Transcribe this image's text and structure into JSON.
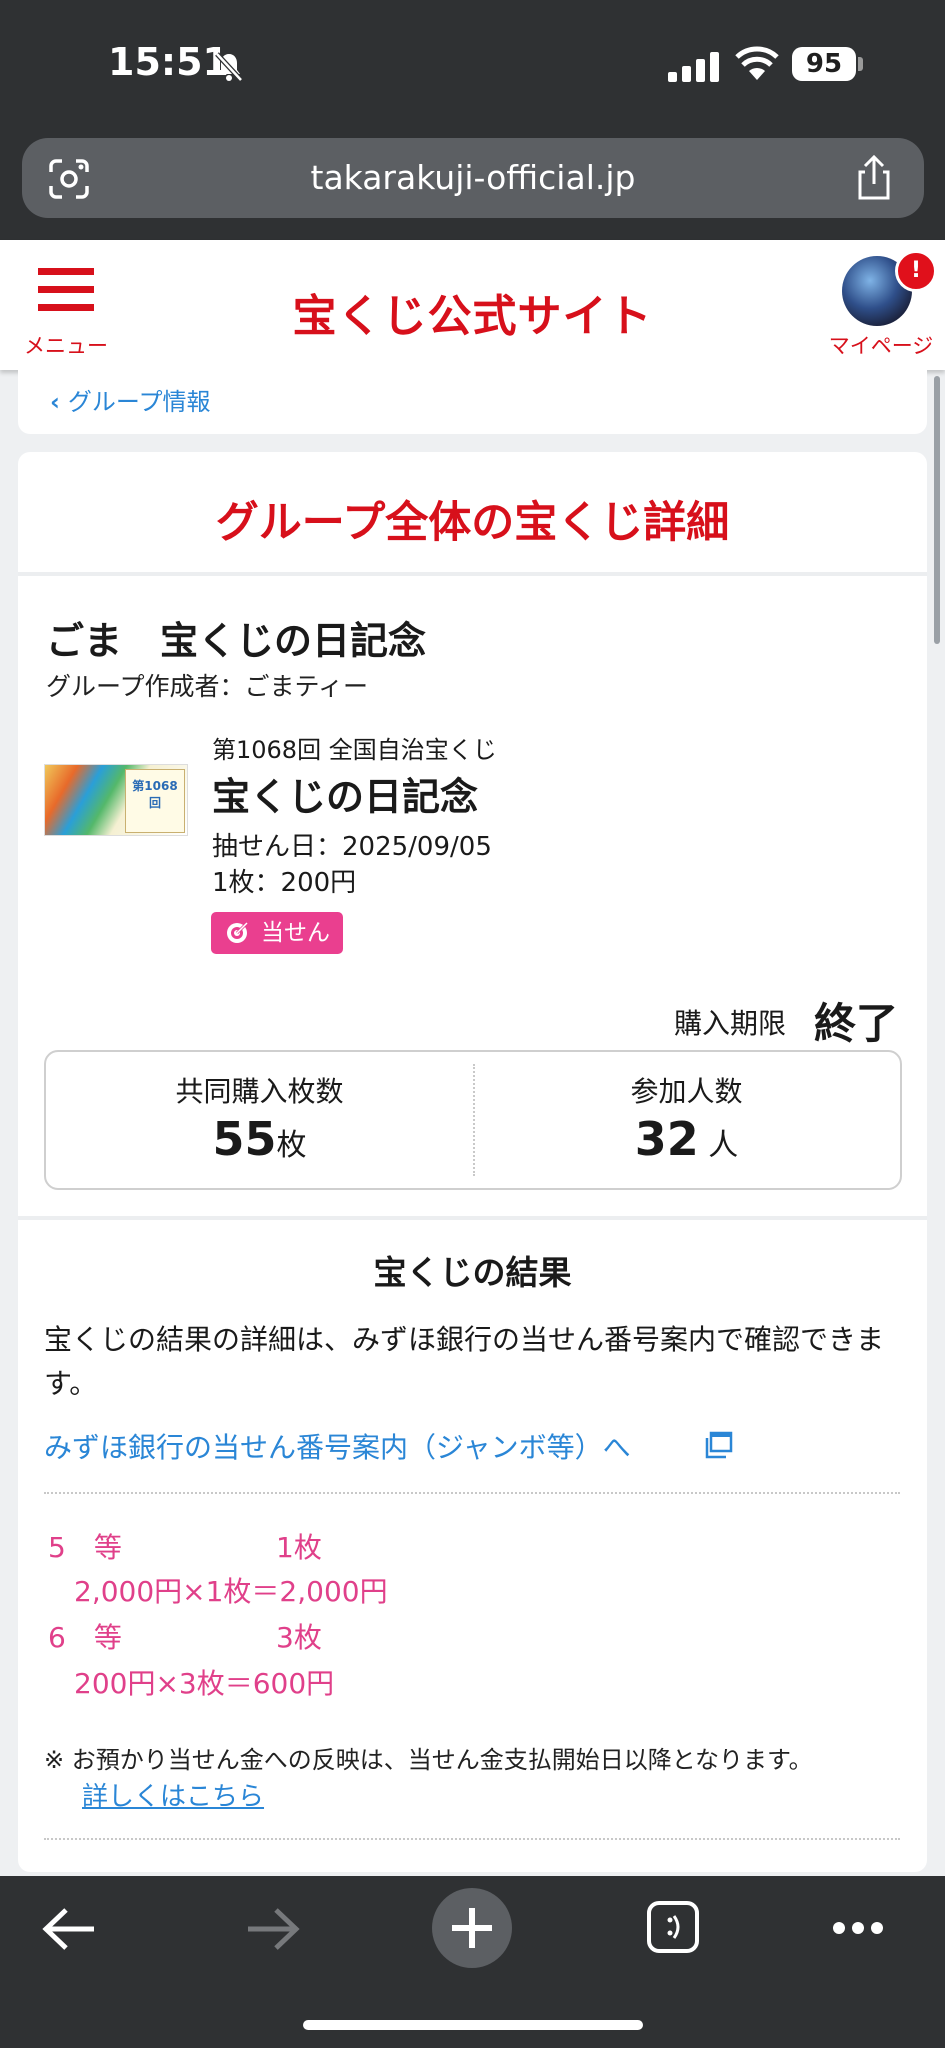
{
  "status_bar": {
    "time": "15:51",
    "battery": "95"
  },
  "browser": {
    "url": "takarakuji-official.jp"
  },
  "site_header": {
    "menu_label": "メニュー",
    "logo": "宝くじ公式サイト",
    "mypage_label": "マイページ",
    "notification_badge": "!"
  },
  "breadcrumb": {
    "back_label": "グループ情報"
  },
  "page": {
    "title": "グループ全体の宝くじ詳細",
    "group_name": "ごま　宝くじの日記念",
    "creator": "グループ作成者：ごまティー",
    "lottery": {
      "round": "第1068回 全国自治宝くじ",
      "name": "宝くじの日記念",
      "draw_date": "抽せん日：2025/09/05",
      "price": "1枚：200円",
      "status_button": "当せん",
      "ticket_image_text": "第1068回"
    },
    "deadline": {
      "label": "購入期限",
      "value": "終了"
    },
    "stats": [
      {
        "label": "共同購入枚数",
        "value": "55",
        "unit": "枚"
      },
      {
        "label": "参加人数",
        "value": "32",
        "unit": " 人"
      }
    ],
    "results": {
      "title": "宝くじの結果",
      "description": "宝くじの結果の詳細は、みずほ銀行の当せん番号案内で確認できます。",
      "link": "みずほ銀行の当せん番号案内（ジャンボ等）へ",
      "prizes": [
        {
          "rank": "5　等",
          "count": "1枚",
          "calc": "2,000円×1枚＝2,000円"
        },
        {
          "rank": "6　等",
          "count": "3枚",
          "calc": "200円×3枚＝600円"
        }
      ],
      "note": "※ お預かり当せん金への反映は、当せん金支払開始日以降となります。",
      "note_link": "詳しくはこちら"
    }
  },
  "colors": {
    "brand_red": "#d7101b",
    "link_blue": "#2a86d6",
    "prize_pink": "#e0408a",
    "win_button": "#ea3f8f"
  }
}
